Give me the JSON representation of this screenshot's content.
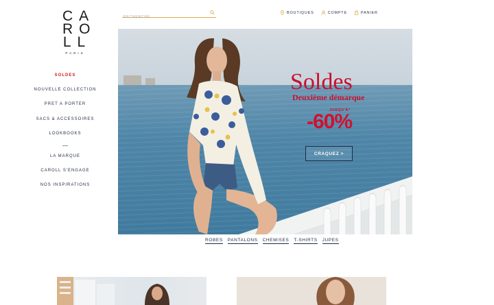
{
  "brand": {
    "logo_rows": [
      "CA",
      "RO",
      "LL"
    ],
    "logo_sub": "PARIS"
  },
  "search": {
    "placeholder": "RECHERCHE"
  },
  "top_links": [
    {
      "label": "BOUTIQUES",
      "icon": "location-pin-icon"
    },
    {
      "label": "COMPTE",
      "icon": "user-icon"
    },
    {
      "label": "PANIER",
      "icon": "bag-icon"
    }
  ],
  "sidebar": {
    "items": [
      {
        "label": "SOLDES",
        "active": true
      },
      {
        "label": "NOUVELLE COLLECTION"
      },
      {
        "label": "PRET A PORTER"
      },
      {
        "label": "SACS & ACCESSOIRES"
      },
      {
        "label": "LOOKBOOKS"
      },
      {
        "label": "—"
      },
      {
        "label": "LA MARQUE"
      },
      {
        "label": "CAROLL S'ENGAGE"
      },
      {
        "label": "NOS INSPIRATIONS"
      }
    ]
  },
  "hero": {
    "title": "Soldes",
    "subtitle": "Deuxième démarque",
    "upto": "JUSQU'À*",
    "discount": "-60%",
    "cta_label": "CRAQUEZ >"
  },
  "categories": [
    "ROBES",
    "PANTALONS",
    "CHEMISES",
    "T-SHIRTS",
    "JUPES"
  ],
  "colors": {
    "accent_red": "#c8102e",
    "navy": "#1f2a44",
    "search_underline": "#e0a850"
  }
}
